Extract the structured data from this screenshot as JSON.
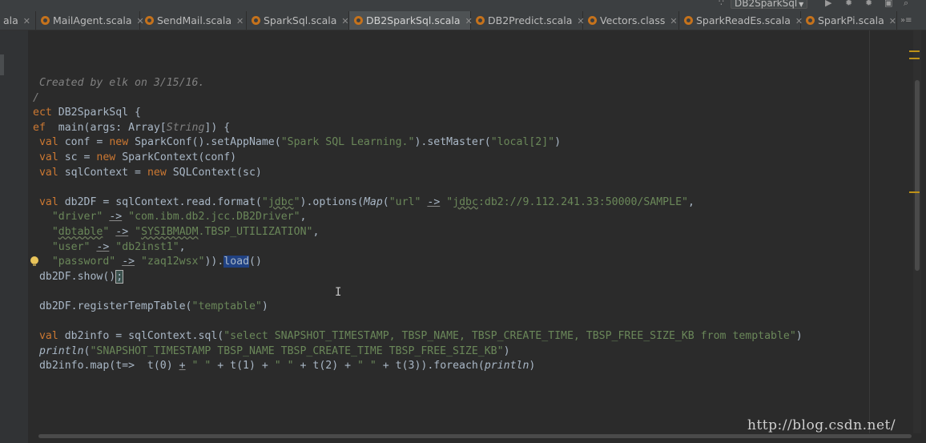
{
  "run_config": {
    "label": "DB2SparkSql"
  },
  "tabs": [
    {
      "label": "ala",
      "active": false
    },
    {
      "label": "MailAgent.scala",
      "active": false
    },
    {
      "label": "SendMail.scala",
      "active": false
    },
    {
      "label": "SparkSql.scala",
      "active": false
    },
    {
      "label": "DB2SparkSql.scala",
      "active": true
    },
    {
      "label": "DB2Predict.scala",
      "active": false
    },
    {
      "label": "Vectors.class",
      "active": false
    },
    {
      "label": "SparkReadEs.scala",
      "active": false
    },
    {
      "label": "SparkPi.scala",
      "active": false
    }
  ],
  "tab_overflow": "»≡",
  "code_lines": [
    [
      {
        "t": " Created by elk on 3/15/16.",
        "c": "cm"
      }
    ],
    [
      {
        "t": "/",
        "c": "cm"
      }
    ],
    [
      {
        "t": "ect",
        "c": "kw"
      },
      {
        "t": " DB2SparkSql {"
      }
    ],
    [
      {
        "t": "ef",
        "c": "kw"
      },
      {
        "t": "  main(args: Array["
      },
      {
        "t": "String",
        "c": "cm"
      },
      {
        "t": "]) {"
      }
    ],
    [
      {
        "t": " "
      },
      {
        "t": "val",
        "c": "kw"
      },
      {
        "t": " conf = "
      },
      {
        "t": "new",
        "c": "kw"
      },
      {
        "t": " SparkConf().setAppName("
      },
      {
        "t": "\"Spark SQL Learning.\"",
        "c": "str"
      },
      {
        "t": ").setMaster("
      },
      {
        "t": "\"local[2]\"",
        "c": "str"
      },
      {
        "t": ")"
      }
    ],
    [
      {
        "t": " "
      },
      {
        "t": "val",
        "c": "kw"
      },
      {
        "t": " sc = "
      },
      {
        "t": "new",
        "c": "kw"
      },
      {
        "t": " SparkContext(conf)"
      }
    ],
    [
      {
        "t": " "
      },
      {
        "t": "val",
        "c": "kw"
      },
      {
        "t": " sqlContext = "
      },
      {
        "t": "new",
        "c": "kw"
      },
      {
        "t": " SQLContext(sc)"
      }
    ],
    [
      {
        "t": ""
      }
    ],
    [
      {
        "t": " "
      },
      {
        "t": "val",
        "c": "kw"
      },
      {
        "t": " db2DF = sqlContext.read.format("
      },
      {
        "t": "\"",
        "c": "str"
      },
      {
        "t": "jdbc",
        "c": "str wavy"
      },
      {
        "t": "\"",
        "c": "str"
      },
      {
        "t": ").options("
      },
      {
        "t": "Map",
        "c": "it"
      },
      {
        "t": "("
      },
      {
        "t": "\"url\"",
        "c": "str"
      },
      {
        "t": " "
      },
      {
        "t": "->",
        "c": "ul"
      },
      {
        "t": " "
      },
      {
        "t": "\"",
        "c": "str"
      },
      {
        "t": "jdbc",
        "c": "str wavy"
      },
      {
        "t": ":db2://9.112.241.33:50000/SAMPLE\"",
        "c": "str"
      },
      {
        "t": ","
      }
    ],
    [
      {
        "t": "   "
      },
      {
        "t": "\"driver\"",
        "c": "str"
      },
      {
        "t": " "
      },
      {
        "t": "->",
        "c": "ul"
      },
      {
        "t": " "
      },
      {
        "t": "\"com.ibm.db2.jcc.DB2Driver\"",
        "c": "str"
      },
      {
        "t": ","
      }
    ],
    [
      {
        "t": "   "
      },
      {
        "t": "\"",
        "c": "str"
      },
      {
        "t": "dbtable",
        "c": "str wavy"
      },
      {
        "t": "\"",
        "c": "str"
      },
      {
        "t": " "
      },
      {
        "t": "->",
        "c": "ul"
      },
      {
        "t": " "
      },
      {
        "t": "\"",
        "c": "str"
      },
      {
        "t": "SYSIBMADM",
        "c": "str wavy"
      },
      {
        "t": ".TBSP_UTILIZATION\"",
        "c": "str"
      },
      {
        "t": ","
      }
    ],
    [
      {
        "t": "   "
      },
      {
        "t": "\"user\"",
        "c": "str"
      },
      {
        "t": " "
      },
      {
        "t": "->",
        "c": "ul"
      },
      {
        "t": " "
      },
      {
        "t": "\"db2inst1\"",
        "c": "str"
      },
      {
        "t": ","
      }
    ],
    [
      {
        "t": "   "
      },
      {
        "t": "\"password\"",
        "c": "str"
      },
      {
        "t": " "
      },
      {
        "t": "->",
        "c": "ul"
      },
      {
        "t": " "
      },
      {
        "t": "\"zaq12wsx\"",
        "c": "str"
      },
      {
        "t": "))."
      },
      {
        "t": "load",
        "c": "sel"
      },
      {
        "t": "()"
      }
    ],
    [
      {
        "t": " db2DF.show()"
      },
      {
        "t": ";",
        "c": "brace"
      }
    ],
    [
      {
        "t": ""
      }
    ],
    [
      {
        "t": " db2DF.registerTempTable("
      },
      {
        "t": "\"temptable\"",
        "c": "str"
      },
      {
        "t": ")"
      }
    ],
    [
      {
        "t": ""
      }
    ],
    [
      {
        "t": " "
      },
      {
        "t": "val",
        "c": "kw"
      },
      {
        "t": " db2info = sqlContext.sql("
      },
      {
        "t": "\"select SNAPSHOT_TIMESTAMP, TBSP_NAME, TBSP_CREATE_TIME, TBSP_FREE_SIZE_KB from temptable\"",
        "c": "str"
      },
      {
        "t": ")"
      }
    ],
    [
      {
        "t": " "
      },
      {
        "t": "println",
        "c": "it"
      },
      {
        "t": "("
      },
      {
        "t": "\"SNAPSHOT_TIMESTAMP TBSP_NAME TBSP_CREATE_TIME TBSP_FREE_SIZE_KB\"",
        "c": "str"
      },
      {
        "t": ")"
      }
    ],
    [
      {
        "t": " db2info.map(t=>  t(0) "
      },
      {
        "t": "+",
        "c": "ul"
      },
      {
        "t": " "
      },
      {
        "t": "\" \"",
        "c": "str"
      },
      {
        "t": " + t(1) + "
      },
      {
        "t": "\" \"",
        "c": "str"
      },
      {
        "t": " + t(2) + "
      },
      {
        "t": "\" \"",
        "c": "str"
      },
      {
        "t": " + t(3)).foreach("
      },
      {
        "t": "println",
        "c": "it"
      },
      {
        "t": ")"
      }
    ]
  ],
  "text_cursor": "I",
  "watermark": "http://blog.csdn.net/"
}
